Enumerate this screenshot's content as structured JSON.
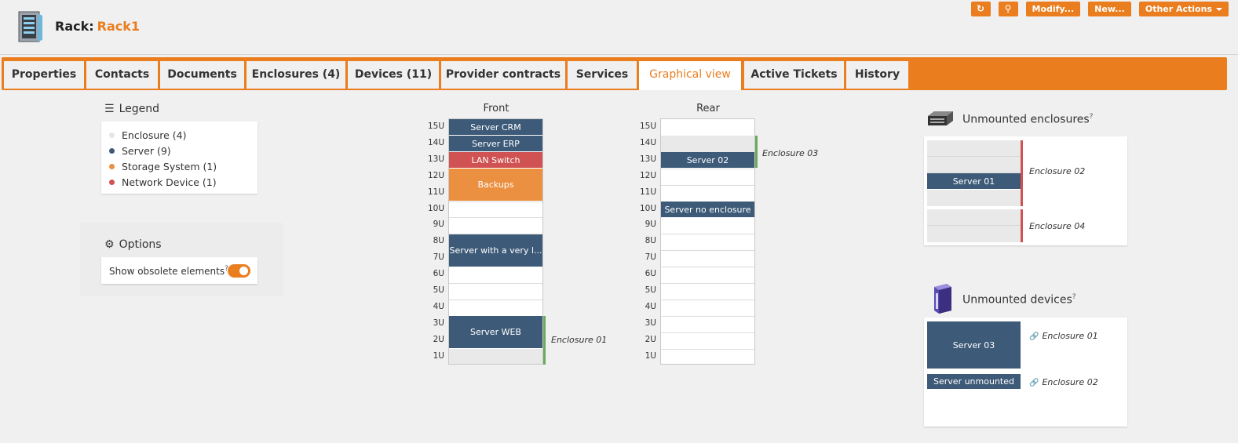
{
  "header": {
    "title_prefix": "Rack:",
    "object_name": "Rack1",
    "buttons": {
      "refresh": "↻",
      "search": "⚲",
      "modify": "Modify...",
      "new": "New...",
      "other_actions": "Other Actions"
    }
  },
  "tabs": [
    {
      "label": "Properties"
    },
    {
      "label": "Contacts"
    },
    {
      "label": "Documents"
    },
    {
      "label": "Enclosures (4)"
    },
    {
      "label": "Devices (11)"
    },
    {
      "label": "Provider contracts"
    },
    {
      "label": "Services"
    },
    {
      "label": "Graphical view"
    },
    {
      "label": "Active Tickets"
    },
    {
      "label": "History"
    }
  ],
  "legend": {
    "title": "Legend",
    "items": [
      {
        "label": "Enclosure (4)",
        "color": "#e6e6e6"
      },
      {
        "label": "Server (9)",
        "color": "#3d5a78"
      },
      {
        "label": "Storage System (1)",
        "color": "#ea9040"
      },
      {
        "label": "Network Device (1)",
        "color": "#d05252"
      }
    ]
  },
  "options": {
    "title": "Options",
    "show_obsolete_label": "Show obsolete elements",
    "help_mark": "?"
  },
  "front": {
    "label": "Front",
    "units": [
      "15U",
      "14U",
      "13U",
      "12U",
      "11U",
      "10U",
      "9U",
      "8U",
      "7U",
      "6U",
      "5U",
      "4U",
      "3U",
      "2U",
      "1U"
    ],
    "devices": {
      "server_crm": "Server CRM",
      "server_erp": "Server ERP",
      "lan_switch": "LAN Switch",
      "backups": "Backups",
      "server_long": "Server with a very l...",
      "server_web": "Server WEB"
    },
    "enclosure_01": "Enclosure 01"
  },
  "rear": {
    "label": "Rear",
    "units": [
      "15U",
      "14U",
      "13U",
      "12U",
      "11U",
      "10U",
      "9U",
      "8U",
      "7U",
      "6U",
      "5U",
      "4U",
      "3U",
      "2U",
      "1U"
    ],
    "devices": {
      "server_02": "Server 02",
      "server_no_enclosure": "Server no enclosure"
    },
    "enclosure_03": "Enclosure 03"
  },
  "unmounted_enclosures": {
    "title": "Unmounted enclosures",
    "help_mark": "?",
    "server_01": "Server 01",
    "enclosure_02": "Enclosure 02",
    "enclosure_04": "Enclosure 04"
  },
  "unmounted_devices": {
    "title": "Unmounted devices",
    "help_mark": "?",
    "server_03": "Server 03",
    "server_03_link": "Enclosure 01",
    "server_unmounted": "Server unmounted",
    "server_unmounted_link": "Enclosure 02"
  },
  "colors": {
    "accent": "#ea7d1e",
    "server": "#3d5a78",
    "storage": "#ea9040",
    "network": "#d05252",
    "enclosure_green": "#6aaa5a",
    "enclosure_red": "#d05252"
  }
}
